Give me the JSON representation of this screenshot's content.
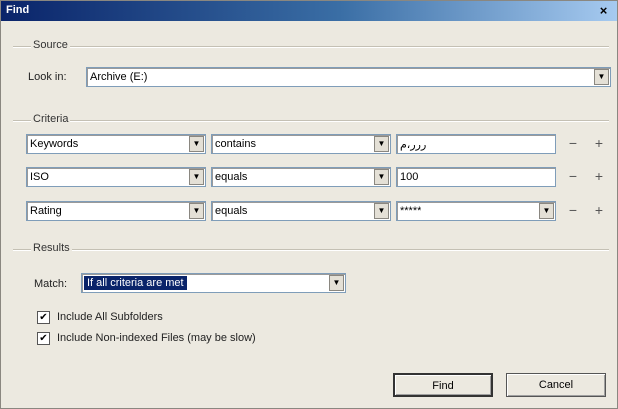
{
  "window": {
    "title": "Find",
    "close_glyph": "×"
  },
  "source": {
    "group_label": "Source",
    "look_in_label": "Look in:",
    "look_in_value": "Archive (E:)"
  },
  "criteria": {
    "group_label": "Criteria",
    "rows": [
      {
        "field": "Keywords",
        "operator": "contains",
        "value": "ررر،م",
        "value_is_combo": false
      },
      {
        "field": "ISO",
        "operator": "equals",
        "value": "100",
        "value_is_combo": false
      },
      {
        "field": "Rating",
        "operator": "equals",
        "value": "*****",
        "value_is_combo": true
      }
    ],
    "minus_glyph": "−",
    "plus_glyph": "+"
  },
  "results": {
    "group_label": "Results",
    "match_label": "Match:",
    "match_value": "If all criteria are met",
    "include_subfolders": {
      "label": "Include All Subfolders",
      "checked": true
    },
    "include_nonindexed": {
      "label": "Include Non-indexed Files (may be slow)",
      "checked": true
    }
  },
  "buttons": {
    "find": "Find",
    "cancel": "Cancel"
  },
  "icons": {
    "dropdown": "chevron-down-icon",
    "check": "checkmark-icon"
  },
  "colors": {
    "title_bar": "#0a246a",
    "selection": "#0a246a",
    "dialog_bg": "#ece9e0"
  }
}
